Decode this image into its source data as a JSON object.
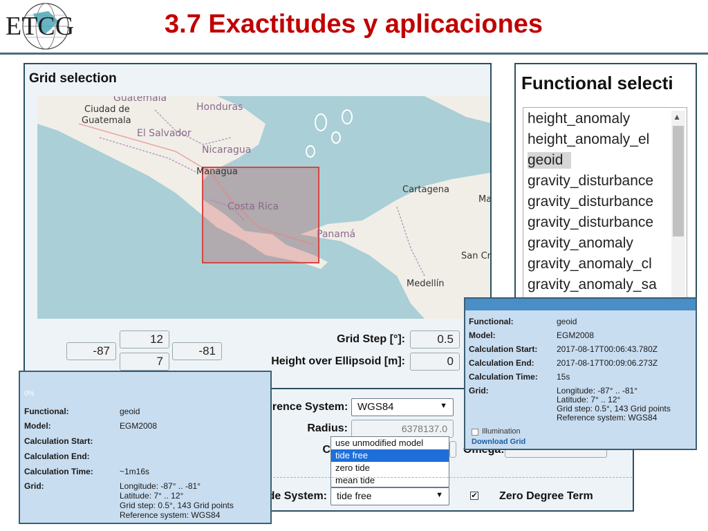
{
  "header": {
    "logo_text": "ETCG",
    "title": "3.7 Exactitudes y aplicaciones"
  },
  "grid_selection": {
    "title": "Grid selection",
    "map_labels": {
      "guatemala_top": "Guatemala",
      "ciudad_de": "Ciudad de",
      "guatemala": "Guatemala",
      "honduras": "Honduras",
      "el_salvador": "El Salvador",
      "nicaragua": "Nicaragua",
      "managua": "Managua",
      "costa_rica": "Costa Rica",
      "cartagena": "Cartagena",
      "panama": "Panamá",
      "san_cr": "San Cr",
      "medellin": "Medellín",
      "ma": "Ma"
    },
    "bounds": {
      "west": "-87",
      "north": "12",
      "south": "7",
      "east": "-81"
    },
    "grid_step_label": "Grid Step [°]:",
    "grid_step_value": "0.5",
    "height_label": "Height over Ellipsoid [m]:",
    "height_value": "0"
  },
  "settings": {
    "reference_system_label": "erence System:",
    "reference_system_value": "WGS84",
    "radius_label": "Radius:",
    "radius_value": "6378137.0",
    "c_label": "C",
    "omega_label": "Omega:",
    "tide_system_label": "de System:",
    "tide_system_value": "tide free",
    "tide_options": [
      "use unmodified model",
      "tide free",
      "zero tide",
      "mean tide"
    ],
    "selected_tide_index": 1,
    "zero_degree_label": "Zero Degree Term"
  },
  "functional_selection": {
    "title": "Functional selecti",
    "items": [
      "height_anomaly",
      "height_anomaly_el",
      "geoid",
      "gravity_disturbance",
      "gravity_disturbance",
      "gravity_disturbance",
      "gravity_anomaly",
      "gravity_anomaly_cl",
      "gravity_anomaly_sa"
    ],
    "selected_index": 2
  },
  "result_left": {
    "progress": "0%",
    "rows": [
      {
        "key": "Functional:",
        "value": "geoid"
      },
      {
        "key": "Model:",
        "value": "EGM2008"
      },
      {
        "key": "Calculation Start:",
        "value": ""
      },
      {
        "key": "Calculation End:",
        "value": ""
      },
      {
        "key": "Calculation Time:",
        "value": "~1m16s"
      }
    ],
    "grid_key": "Grid:",
    "grid_lines": [
      "Longitude: -87° .. -81°",
      "Latitude: 7° .. 12°",
      "Grid step: 0.5°, 143 Grid points",
      "Reference system: WGS84"
    ]
  },
  "result_right": {
    "rows": [
      {
        "key": "Functional:",
        "value": "geoid"
      },
      {
        "key": "Model:",
        "value": "EGM2008"
      },
      {
        "key": "Calculation Start:",
        "value": "2017-08-17T00:06:43.780Z"
      },
      {
        "key": "Calculation End:",
        "value": "2017-08-17T00:09:06.273Z"
      },
      {
        "key": "Calculation Time:",
        "value": "15s"
      }
    ],
    "grid_key": "Grid:",
    "grid_lines": [
      "Longitude: -87° .. -81°",
      "Latitude: 7° .. 12°",
      "Grid step: 0.5°, 143 Grid points",
      "Reference system: WGS84"
    ],
    "illumination_label": "Illumination",
    "download_label": "Download Grid"
  },
  "colors": {
    "title_red": "#c00000",
    "panel_border": "#2b4f5f",
    "info_bg": "#c9ddf0",
    "selection_blue": "#1e6fd9"
  }
}
